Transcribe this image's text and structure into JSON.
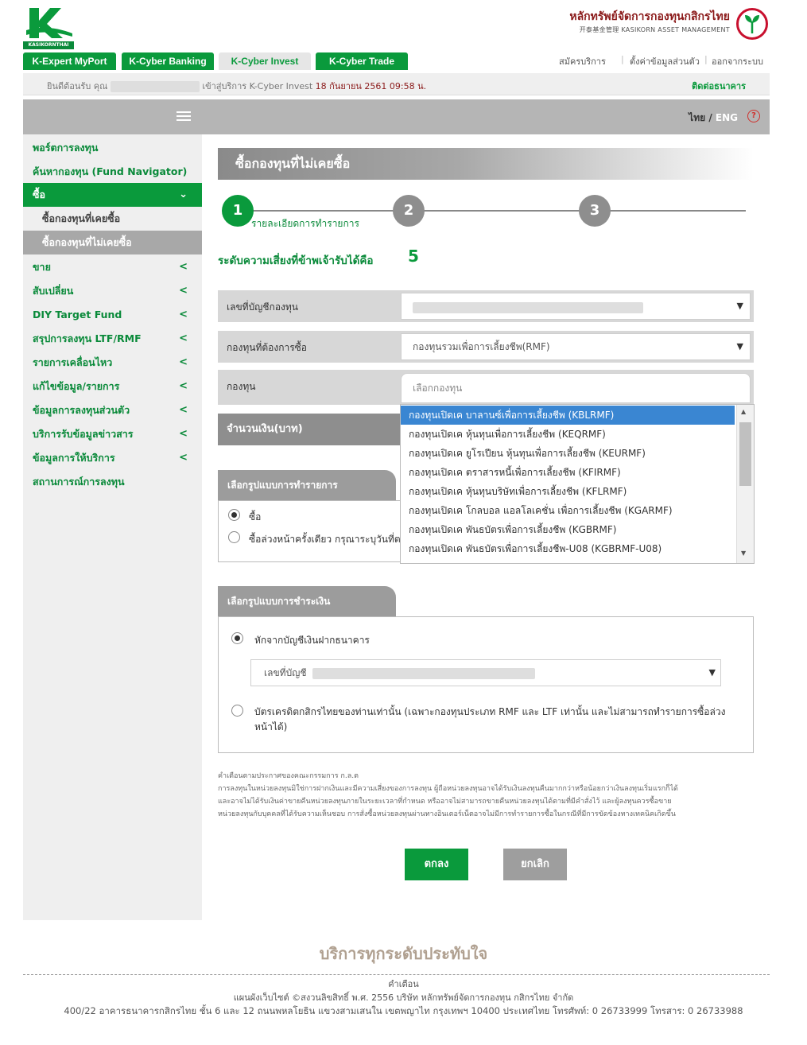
{
  "header": {
    "logo_text": "KASIKORNTHAI",
    "brand_th": "หลักทรัพย์จัดการกองทุนกสิกรไทย",
    "brand_en": "开泰基金管理 KASIKORN ASSET MANAGEMENT",
    "tabs": [
      "K-Expert MyPort",
      "K-Cyber Banking",
      "K-Cyber Invest",
      "K-Cyber Trade"
    ],
    "active_tab": "K-Cyber Invest",
    "top_links": [
      "สมัครบริการ",
      "ตั้งค่าข้อมูลส่วนตัว",
      "ออกจากระบบ"
    ],
    "welcome_prefix": "ยินดีต้อนรับ คุณ",
    "welcome_suffix": "เข้าสู่บริการ K-Cyber Invest",
    "welcome_datetime": "18 กันยายน 2561 09:58 น.",
    "contact": "ติดต่อธนาคาร",
    "lang_th": "ไทย",
    "lang_sep": "/",
    "lang_en": "ENG",
    "help": "?"
  },
  "sidebar": {
    "items": [
      {
        "label": "พอร์ตการลงทุน",
        "chevron": ""
      },
      {
        "label": "ค้นหากองทุน (Fund Navigator)",
        "chevron": ""
      },
      {
        "label": "ซื้อ",
        "chevron": "⌄"
      },
      {
        "label": "ซื้อกองทุนที่เคยซื้อ",
        "chevron": ""
      },
      {
        "label": "ซื้อกองทุนที่ไม่เคยซื้อ",
        "chevron": ""
      },
      {
        "label": "ขาย",
        "chevron": "<"
      },
      {
        "label": "สับเปลี่ยน",
        "chevron": "<"
      },
      {
        "label": "DIY Target Fund",
        "chevron": "<"
      },
      {
        "label": "สรุปการลงทุน LTF/RMF",
        "chevron": "<"
      },
      {
        "label": "รายการเคลื่อนไหว",
        "chevron": "<"
      },
      {
        "label": "แก้ไขข้อมูล/รายการ",
        "chevron": "<"
      },
      {
        "label": "ข้อมูลการลงทุนส่วนตัว",
        "chevron": "<"
      },
      {
        "label": "บริการรับข้อมูลข่าวสาร",
        "chevron": "<"
      },
      {
        "label": "ข้อมูลการให้บริการ",
        "chevron": "<"
      },
      {
        "label": "สถานการณ์การลงทุน",
        "chevron": ""
      }
    ]
  },
  "main": {
    "page_title": "ซื้อกองทุนที่ไม่เคยซื้อ",
    "steps": [
      "1",
      "2",
      "3"
    ],
    "step1_label": "รายละเอียดการทำรายการ",
    "risk_label": "ระดับความเสี่ยงที่ข้าพเจ้ารับได้คือ",
    "risk_value": "5",
    "fields": {
      "account_label": "เลขที่บัญชีกองทุน",
      "fund_type_label": "กองทุนที่ต้องการซื้อ",
      "fund_type_value": "กองทุนรวมเพื่อการเลี้ยงชีพ(RMF)",
      "fund_label": "กองทุน",
      "fund_placeholder": "เลือกกองทุน",
      "amount_label": "จำนวนเงิน(บาท)"
    },
    "dropdown_options": [
      "กองทุนเปิดเค บาลานซ์เพื่อการเลี้ยงชีพ (KBLRMF)",
      "กองทุนเปิดเค หุ้นทุนเพื่อการเลี้ยงชีพ (KEQRMF)",
      "กองทุนเปิดเค ยูโรเปียน หุ้นทุนเพื่อการเลี้ยงชีพ (KEURMF)",
      "กองทุนเปิดเค ตราสารหนี้เพื่อการเลี้ยงชีพ (KFIRMF)",
      "กองทุนเปิดเค หุ้นทุนบริษัทเพื่อการเลี้ยงชีพ (KFLRMF)",
      "กองทุนเปิดเค โกลบอล แอลโลเคชั่น เพื่อการเลี้ยงชีพ (KGARMF)",
      "กองทุนเปิดเค พันธบัตรเพื่อการเลี้ยงชีพ (KGBRMF)",
      "กองทุนเปิดเค พันธบัตรเพื่อการเลี้ยงชีพ-U08 (KGBRMF-U08)"
    ],
    "selected_option_index": 0,
    "transaction_section": {
      "title": "เลือกรูปแบบการทำรายการ",
      "option_buy": "ซื้อ",
      "option_advance": "ซื้อล่วงหน้าครั้งเดียว กรุณาระบุวันที่ต"
    },
    "payment_section": {
      "title": "เลือกรูปแบบการชำระเงิน",
      "option_bank": "หักจากบัญชีเงินฝากธนาคาร",
      "account_placeholder": "เลขที่บัญชี",
      "option_card": "บัตรเครดิตกสิกรไทยของท่านเท่านั้น (เฉพาะกองทุนประเภท RMF และ LTF เท่านั้น และไม่สามารถทำรายการซื้อล่วง",
      "option_card_line2": "หน้าได้)"
    },
    "disclaimer": {
      "title": "คำเตือนตามประกาศของคณะกรรมการ ก.ล.ต",
      "line1": "การลงทุนในหน่วยลงทุนมิใช่การฝากเงินและมีความเสี่ยงของการลงทุน ผู้ถือหน่วยลงทุนอาจได้รับเงินลงทุนคืนมากกว่าหรือน้อยกว่าเงินลงทุนเริ่มแรกก็ได้",
      "line2": "และอาจไม่ได้รับเงินค่าขายคืนหน่วยลงทุนภายในระยะเวลาที่กำหนด หรืออาจไม่สามารถขายคืนหน่วยลงทุนได้ตามที่มีคำสั่งไว้ และผู้ลงทุนควรซื้อขาย",
      "line3": "หน่วยลงทุนกับบุคคลที่ได้รับความเห็นชอบ การสั่งซื้อหน่วยลงทุนผ่านทางอินเตอร์เน็ตอาจไม่มีการทำรายการซื้อในกรณีที่มีการขัดข้องทางเทคนิคเกิดขึ้น"
    },
    "buttons": {
      "ok": "ตกลง",
      "cancel": "ยกเลิก"
    }
  },
  "footer": {
    "slogan": "บริการทุกระดับประทับใจ",
    "warning": "คำเตือน",
    "copyright": "แผนผังเว็บไซต์ ©สงวนลิขสิทธิ์ พ.ศ. 2556 บริษัท หลักทรัพย์จัดการกองทุน กสิกรไทย จำกัด",
    "address": "400/22 อาคารธนาคารกสิกรไทย ชั้น 6 และ 12 ถนนพหลโยธิน แขวงสามเสนใน เขตพญาไท กรุงเทพฯ 10400 ประเทศไทย โทรศัพท์: 0 26733999 โทรสาร: 0 26733988"
  },
  "colors": {
    "brand_green": "#0a9a3c",
    "select_blue": "#3a86d2",
    "sidebar_bg": "#efefef"
  }
}
